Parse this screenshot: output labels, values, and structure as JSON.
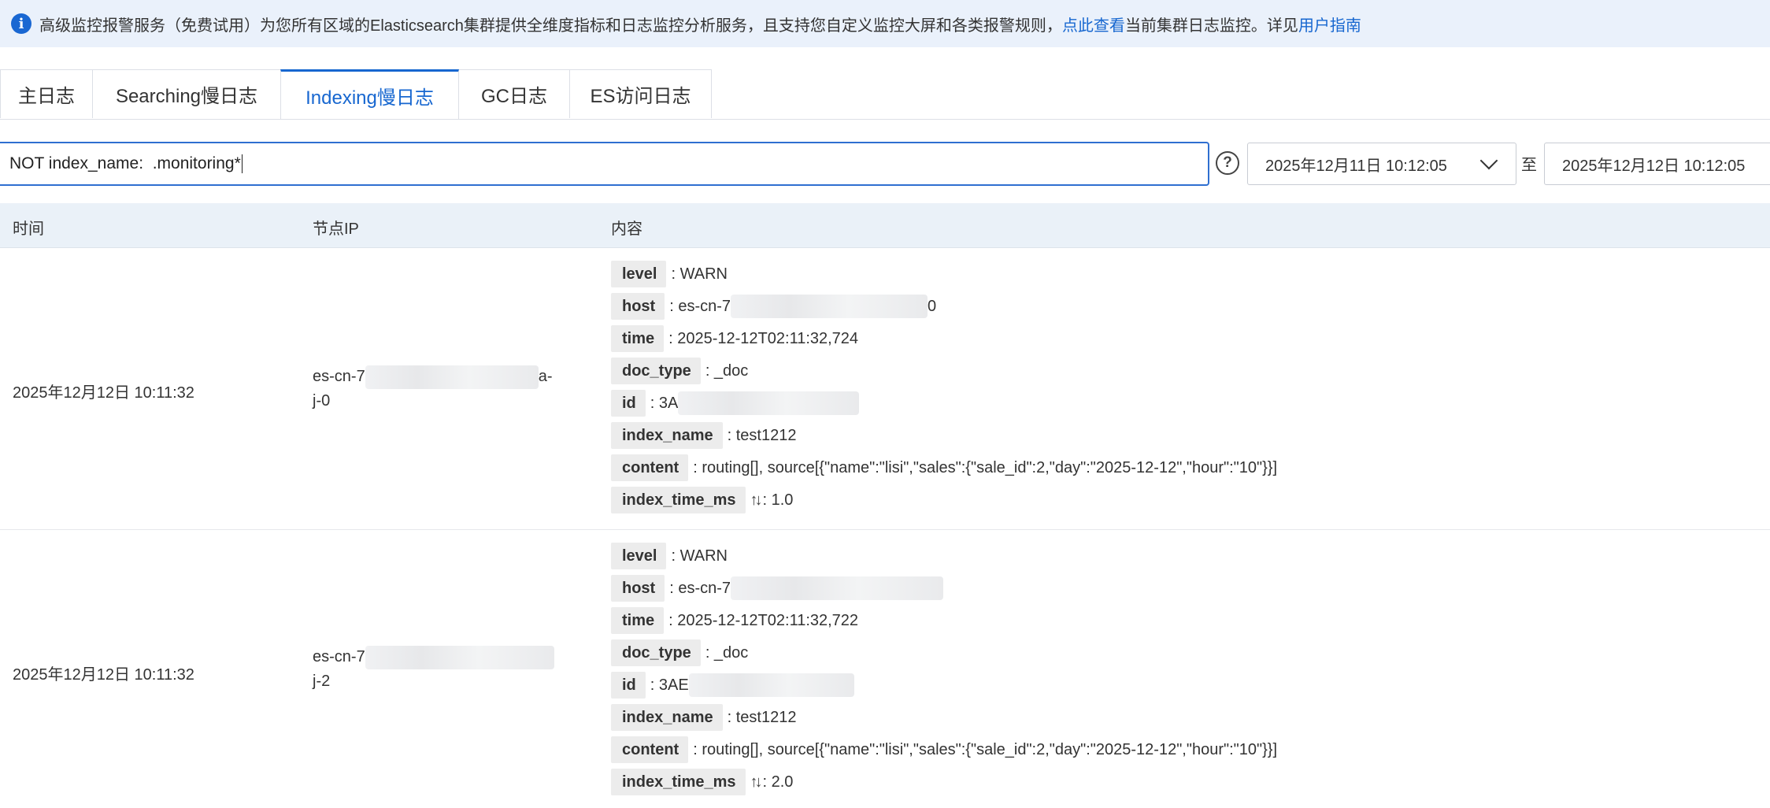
{
  "notice": {
    "icon": "info-icon",
    "text_before": "高级监控报警服务（免费试用）为您所有区域的Elasticsearch集群提供全维度指标和日志监控分析服务，且支持您自定义监控大屏和各类报警规则，",
    "link_view": "点此查看",
    "text_middle": "当前集群日志监控。详见",
    "link_guide": "用户指南"
  },
  "tabs": [
    {
      "label": "主日志"
    },
    {
      "label": "Searching慢日志"
    },
    {
      "label": "Indexing慢日志"
    },
    {
      "label": "GC日志"
    },
    {
      "label": "ES访问日志"
    }
  ],
  "active_tab": "Indexing慢日志",
  "search": {
    "value": "NOT index_name:  .monitoring*"
  },
  "date_range": {
    "start": "2025年12月11日 10:12:05",
    "separator": "至",
    "end": "2025年12月12日 10:12:05"
  },
  "table": {
    "headers": {
      "time": "时间",
      "ip": "节点IP",
      "content": "内容"
    },
    "rows": [
      {
        "time": "2025年12月12日 10:11:32",
        "ip_prefix": "es-cn-7",
        "ip_suffix": "a-",
        "ip_line2": "j-0",
        "fields": [
          {
            "key": "level",
            "value": ": WARN"
          },
          {
            "key": "host",
            "value": ": es-cn-7",
            "tail": "0"
          },
          {
            "key": "time",
            "value": ": 2025-12-12T02:11:32,724"
          },
          {
            "key": "doc_type",
            "value": ": _doc"
          },
          {
            "key": "id",
            "value": ": 3A"
          },
          {
            "key": "index_name",
            "value": ": test1212"
          },
          {
            "key": "content",
            "value": ": routing[], source[{\"name\":\"lisi\",\"sales\":{\"sale_id\":2,\"day\":\"2025-12-12\",\"hour\":\"10\"}}]"
          },
          {
            "key": "index_time_ms",
            "value": ": 1.0"
          }
        ]
      },
      {
        "time": "2025年12月12日 10:11:32",
        "ip_prefix": "es-cn-7",
        "ip_suffix": "",
        "ip_line2": "j-2",
        "fields": [
          {
            "key": "level",
            "value": ": WARN"
          },
          {
            "key": "host",
            "value": ": es-cn-7"
          },
          {
            "key": "time",
            "value": ": 2025-12-12T02:11:32,722"
          },
          {
            "key": "doc_type",
            "value": ": _doc"
          },
          {
            "key": "id",
            "value": ": 3AE"
          },
          {
            "key": "index_name",
            "value": ": test1212"
          },
          {
            "key": "content",
            "value": ": routing[], source[{\"name\":\"lisi\",\"sales\":{\"sale_id\":2,\"day\":\"2025-12-12\",\"hour\":\"10\"}}]"
          },
          {
            "key": "index_time_ms",
            "value": ": 2.0"
          }
        ]
      }
    ]
  },
  "colors": {
    "accent": "#1767d0",
    "banner_bg": "#eaf1fb",
    "header_bg": "#eaf1f8",
    "key_bg": "#ececec"
  }
}
